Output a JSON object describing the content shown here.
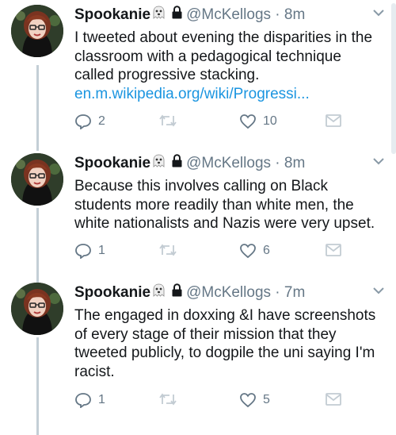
{
  "tweets": [
    {
      "name": "Spookanie",
      "handle": "@McKellogs",
      "separator": "·",
      "time": "8m",
      "lines": [
        "I tweeted about evening the disparities in the",
        "classroom with a pedagogical technique",
        "called progressive stacking."
      ],
      "link": "en.m.wikipedia.org/wiki/Progressi...",
      "replies": "2",
      "likes": "10"
    },
    {
      "name": "Spookanie",
      "handle": "@McKellogs",
      "separator": "·",
      "time": "8m",
      "lines": [
        "Because this involves calling on Black",
        "students more readily than white men, the",
        "white nationalists and Nazis were very upset."
      ],
      "replies": "1",
      "likes": "6"
    },
    {
      "name": "Spookanie",
      "handle": "@McKellogs",
      "separator": "·",
      "time": "7m",
      "lines": [
        "The engaged in doxxing &I have screenshots",
        "of every stage of their mission that they",
        "tweeted publicly, to dogpile the uni saying I'm",
        "racist."
      ],
      "replies": "1",
      "likes": "5"
    }
  ],
  "icons": {
    "name_emoji": "ghost-emoji-icon",
    "protected": "lock-icon",
    "menu": "chevron-down-icon",
    "reply": "reply-icon",
    "retweet": "retweet-icon",
    "like": "heart-icon",
    "dm": "envelope-icon"
  },
  "colors": {
    "text": "#14171a",
    "muted": "#657786",
    "link": "#1b95e0",
    "thread_line": "#c4cfd6"
  }
}
